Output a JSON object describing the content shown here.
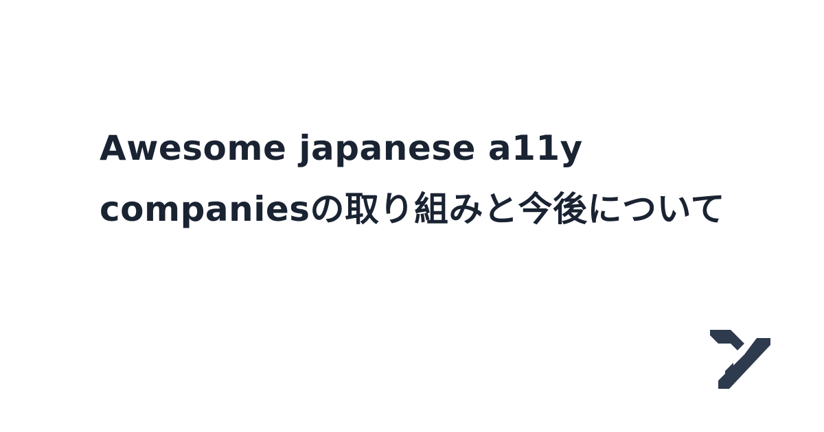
{
  "card": {
    "title": "Awesome japanese a11y companiesの取り組みと今後について"
  },
  "logo": {
    "icon": "y-logo-icon",
    "color": "#2e3a4d"
  },
  "colors": {
    "background": "#ffffff",
    "title_text": "#1a2332"
  }
}
